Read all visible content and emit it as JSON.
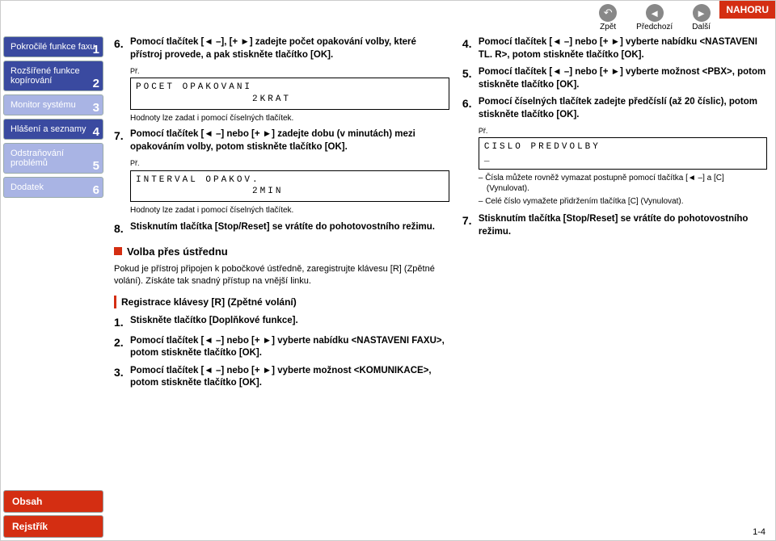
{
  "header": {
    "nahoru": "NAHORU",
    "zpet": "Zpět",
    "predchozi": "Předchozí",
    "dalsi": "Další"
  },
  "sidebar": {
    "items": [
      {
        "label": "Pokročilé funkce faxu",
        "num": "1"
      },
      {
        "label": "Rozšířené funkce kopírování",
        "num": "2"
      },
      {
        "label": "Monitor systému",
        "num": "3"
      },
      {
        "label": "Hlášení a seznamy",
        "num": "4"
      },
      {
        "label": "Odstraňování problémů",
        "num": "5"
      },
      {
        "label": "Dodatek",
        "num": "6"
      }
    ],
    "obsah": "Obsah",
    "rejstrik": "Rejstřík"
  },
  "col1": {
    "s6_num": "6.",
    "s6_text": "Pomocí tlačítek [◄ –], [+ ►] zadejte počet opakování volby, které přístroj provede, a pak stiskněte tlačítko [OK].",
    "pr": "Př.",
    "code6": "POCET OPAKOVANI\n               2KRAT",
    "note6": "Hodnoty lze zadat i pomocí číselných tlačítek.",
    "s7_num": "7.",
    "s7_text": "Pomocí tlačítek [◄ –] nebo [+ ►] zadejte dobu (v minutách) mezi opakováním volby, potom stiskněte tlačítko [OK].",
    "code7": "INTERVAL OPAKOV.\n               2MIN",
    "note7": "Hodnoty lze zadat i pomocí číselných tlačítek.",
    "s8_num": "8.",
    "s8_text": "Stisknutím tlačítka [Stop/Reset] se vrátíte do pohotovostního režimu.",
    "subhead": "Volba přes ústřednu",
    "para": "Pokud je přístroj připojen k pobočkové ústředně, zaregistrujte klávesu [R] (Zpětné volání). Získáte tak snadný přístup na vnější linku.",
    "reg_title": "Registrace klávesy [R] (Zpětné volání)",
    "reg1_num": "1.",
    "reg1_text": "Stiskněte tlačítko [Doplňkové funkce].",
    "reg2_num": "2.",
    "reg2_text": "Pomocí tlačítek [◄ –] nebo [+ ►] vyberte nabídku <NASTAVENI FAXU>, potom stiskněte tlačítko [OK].",
    "reg3_num": "3.",
    "reg3_text": "Pomocí tlačítek [◄ –] nebo [+ ►] vyberte možnost <KOMUNIKACE>, potom stiskněte tlačítko [OK]."
  },
  "col2": {
    "s4_num": "4.",
    "s4_text": "Pomocí tlačítek [◄ –] nebo [+ ►] vyberte nabídku <NASTAVENI TL. R>, potom stiskněte tlačítko [OK].",
    "s5_num": "5.",
    "s5_text": "Pomocí tlačítek [◄ –] nebo [+ ►] vyberte možnost <PBX>, potom stiskněte tlačítko [OK].",
    "s6_num": "6.",
    "s6_text": "Pomocí číselných tlačítek zadejte předčíslí (až 20 číslic), potom stiskněte tlačítko [OK].",
    "pr": "Př.",
    "code6": "CISLO PREDVOLBY\n_",
    "dash1": "– Čísla můžete rovněž vymazat postupně pomocí tlačítka [◄ –] a [C] (Vynulovat).",
    "dash2": "– Celé číslo vymažete přidržením tlačítka [C] (Vynulovat).",
    "s7_num": "7.",
    "s7_text": "Stisknutím tlačítka [Stop/Reset] se vrátíte do pohotovostního režimu."
  },
  "page_num": "1-4"
}
